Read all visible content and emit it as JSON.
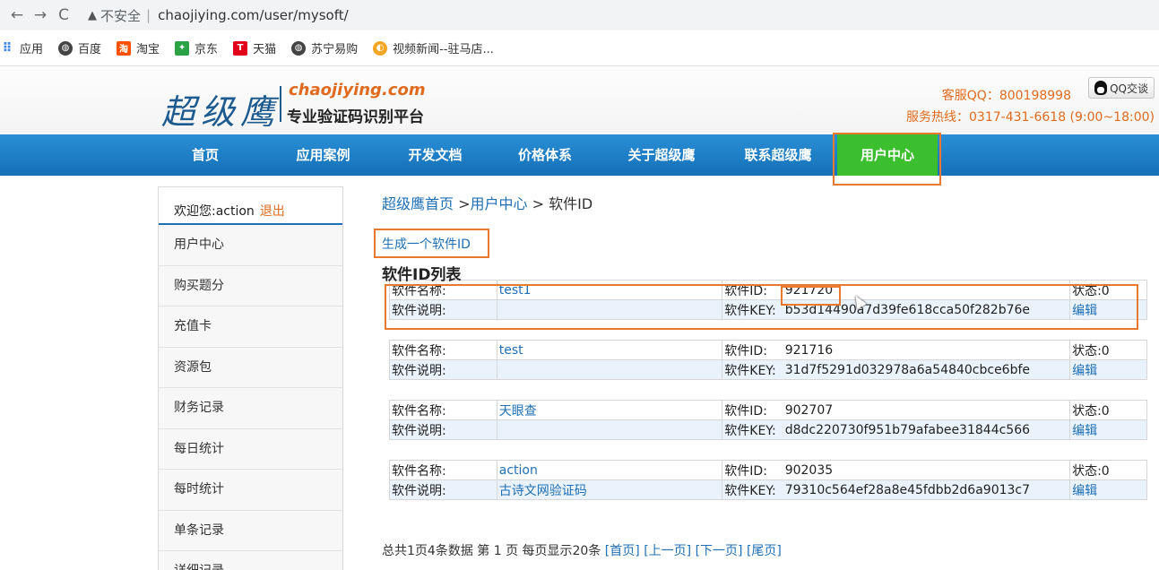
{
  "browser": {
    "back": "←",
    "forward": "→",
    "reload": "C",
    "insecure_label": "不安全",
    "url": "chaojiying.com/user/mysoft/"
  },
  "bookmarks": [
    {
      "label": "应用",
      "icon": "apps-grid-icon",
      "color": "#4285f4"
    },
    {
      "label": "百度",
      "icon": "globe-icon",
      "color": "#444444"
    },
    {
      "label": "淘宝",
      "icon": "taobao-icon",
      "color": "#ff5000"
    },
    {
      "label": "京东",
      "icon": "jd-icon",
      "color": "#2ba245"
    },
    {
      "label": "天猫",
      "icon": "tmall-icon",
      "color": "#e0001b"
    },
    {
      "label": "苏宁易购",
      "icon": "globe-icon",
      "color": "#444444"
    },
    {
      "label": "视频新闻--驻马店...",
      "icon": "video-news-icon",
      "color": "#f5a623"
    }
  ],
  "header": {
    "logo_cn": "超级鹰",
    "logo_en": "chaojiying.com",
    "logo_sub": "专业验证码识别平台",
    "service_qq": "客服QQ：800198998",
    "qq_button": "QQ交谈",
    "service_phone": "服务热线：0317-431-6618 (9:00~18:00)"
  },
  "nav": [
    "首页",
    "应用案例",
    "开发文档",
    "价格体系",
    "关于超级鹰",
    "联系超级鹰",
    "用户中心"
  ],
  "sidebar": {
    "welcome": "欢迎您:action",
    "logout": "退出",
    "items": [
      "用户中心",
      "购买题分",
      "充值卡",
      "资源包",
      "财务记录",
      "每日统计",
      "每时统计",
      "单条记录",
      "详细记录"
    ]
  },
  "main": {
    "breadcrumb": {
      "home": "超级鹰首页",
      "sep1": " >",
      "user": "用户中心",
      "sep2": " > ",
      "current": "软件ID"
    },
    "generate_link": "生成一个软件ID",
    "list_title": "软件ID列表",
    "labels": {
      "name": "软件名称:",
      "desc": "软件说明:",
      "id": "软件ID:",
      "key": "软件KEY:",
      "edit": "编辑"
    },
    "software": [
      {
        "name": "test1",
        "desc": "",
        "id": "921720",
        "key": "b53d14490a7d39fe618cca50f282b76e",
        "status": "状态:0"
      },
      {
        "name": "test",
        "desc": "",
        "id": "921716",
        "key": "31d7f5291d032978a6a54840cbce6bfe",
        "status": "状态:0"
      },
      {
        "name": "天眼查",
        "desc": "",
        "id": "902707",
        "key": "d8dc220730f951b79afabee31844c566",
        "status": "状态:0"
      },
      {
        "name": "action",
        "desc": "古诗文网验证码",
        "id": "902035",
        "key": "79310c564ef28a8e45fdbb2d6a9013c7",
        "status": "状态:0"
      }
    ],
    "pager": {
      "summary": "总共1页4条数据 第 1 页 每页显示20条",
      "first": "[首页]",
      "prev": "[上一页]",
      "next": "[下一页]",
      "last": "[尾页]"
    }
  },
  "colors": {
    "nav_blue": "#1570b8",
    "active_green": "#3bbf2e",
    "accent_orange": "#e06b1e",
    "highlight_box": "#e8792e"
  }
}
